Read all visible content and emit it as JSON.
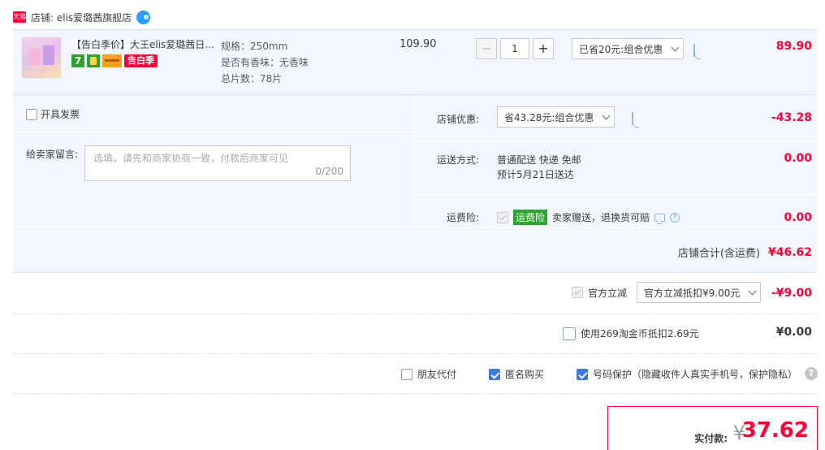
{
  "store": {
    "badge": "天猫",
    "name": "店铺: elis爱璐茜旗舰店"
  },
  "item": {
    "title": "【告白季价】大王elis爱璐茜日...",
    "tag_seven": "7",
    "tag_season": "告白季",
    "sku": [
      "规格：250mm",
      "是否有香味：无香味",
      "总片数：78片"
    ],
    "unit_price": "109.90",
    "qty": "1",
    "qty_minus": "−",
    "qty_plus": "+",
    "discount_select": "已省20元:组合优惠",
    "total": "89.90"
  },
  "panel": {
    "invoice_label": "开具发票",
    "message_label": "给卖家留言:",
    "message_placeholder": "选填，请先和商家协商一致，付款后商家可见",
    "message_count": "0/200",
    "shop_discount_label": "店铺优惠:",
    "shop_discount_select": "省43.28元:组合优惠",
    "shop_discount_amount": "-43.28",
    "shipping_label": "运送方式:",
    "shipping_method": "普通配送 快递 免邮",
    "shipping_eta": "预计5月21日送达",
    "shipping_amount": "0.00",
    "insurance_label": "运费险:",
    "insurance_tag": "运费险",
    "insurance_desc": "卖家赠送，退换货可赔",
    "insurance_amount": "0.00",
    "store_total_label": "店铺合计(含运费)",
    "store_total_amount": "¥46.62"
  },
  "official_discount": {
    "label": "官方立减",
    "select": "官方立减抵扣¥9.00元",
    "amount": "-¥9.00"
  },
  "coins": {
    "label": "使用269淘金币抵扣2.69元",
    "amount": "¥0.00"
  },
  "options": {
    "friend_pay": "朋友代付",
    "anonymous": "匿名购买",
    "phone_protect": "号码保护（隐藏收件人真实手机号，保护隐私）",
    "help": "?"
  },
  "payment": {
    "label": "实付款:",
    "currency": "¥",
    "amount": "37.62"
  },
  "colors": {
    "accent_red": "#ff0036",
    "panel_bg": "#f2f7ff",
    "checkbox_blue": "#3b78e0",
    "insurance_green": "#2da42d"
  }
}
